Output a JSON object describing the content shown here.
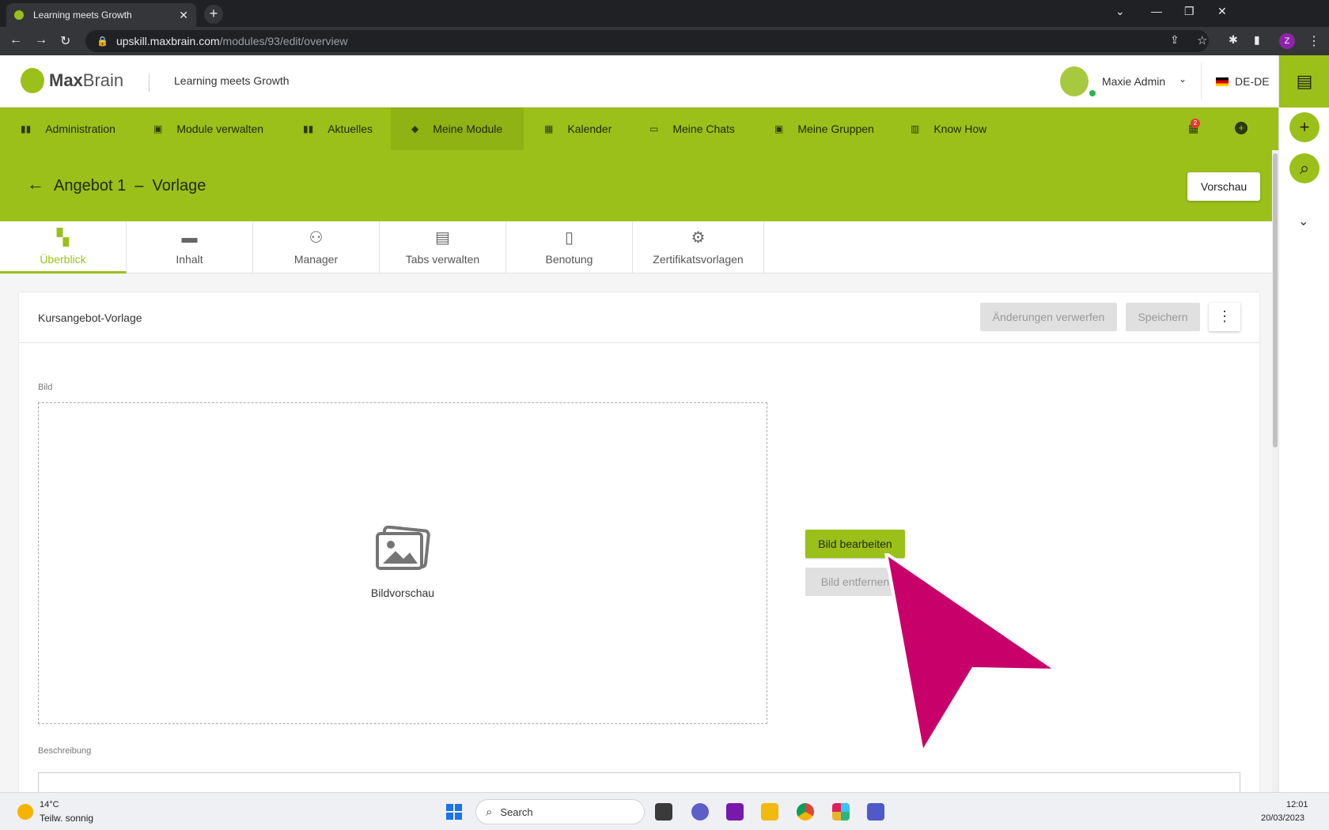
{
  "browser": {
    "tab_title": "Learning meets Growth",
    "tab_close": "✕",
    "new_tab": "+",
    "url_host": "upskill.maxbrain.com",
    "url_path": "/modules/93/edit/overview",
    "profile_initial": "Z"
  },
  "header": {
    "logo_bold": "Max",
    "logo_light": "Brain",
    "tagline": "Learning meets Growth",
    "user_name": "Maxie Admin",
    "language": "DE-DE"
  },
  "nav": {
    "items": [
      {
        "label": "Administration",
        "icon": "chart-icon"
      },
      {
        "label": "Module verwalten",
        "icon": "id-card-icon"
      },
      {
        "label": "Aktuelles",
        "icon": "chart-icon"
      },
      {
        "label": "Meine Module",
        "icon": "graduation-cap-icon"
      },
      {
        "label": "Kalender",
        "icon": "calendar-icon"
      },
      {
        "label": "Meine Chats",
        "icon": "inbox-icon"
      },
      {
        "label": "Meine Gruppen",
        "icon": "group-icon"
      },
      {
        "label": "Know How",
        "icon": "book-icon"
      }
    ],
    "active_index": 3,
    "notification_count": "2"
  },
  "title_band": {
    "title": "Angebot 1  –  Vorlage",
    "preview_label": "Vorschau"
  },
  "subtabs": [
    {
      "label": "Überblick",
      "icon": "dashboard-icon"
    },
    {
      "label": "Inhalt",
      "icon": "folder-icon"
    },
    {
      "label": "Manager",
      "icon": "people-icon"
    },
    {
      "label": "Tabs verwalten",
      "icon": "window-icon"
    },
    {
      "label": "Benotung",
      "icon": "grade-icon"
    },
    {
      "label": "Zertifikatsvorlagen",
      "icon": "certificate-settings-icon"
    }
  ],
  "card": {
    "title": "Kursangebot-Vorlage",
    "discard_label": "Änderungen verwerfen",
    "save_label": "Speichern",
    "image_label": "Bild",
    "image_placeholder": "Bildvorschau",
    "edit_image_label": "Bild bearbeiten",
    "remove_image_label": "Bild entfernen",
    "description_label": "Beschreibung"
  },
  "taskbar": {
    "temperature": "14°C",
    "weather": "Teilw. sonnig",
    "search_label": "Search",
    "time": "12:01",
    "date": "20/03/2023"
  },
  "colors": {
    "brand_green": "#9bc01a",
    "annotation_pointer": "#c8006a"
  }
}
